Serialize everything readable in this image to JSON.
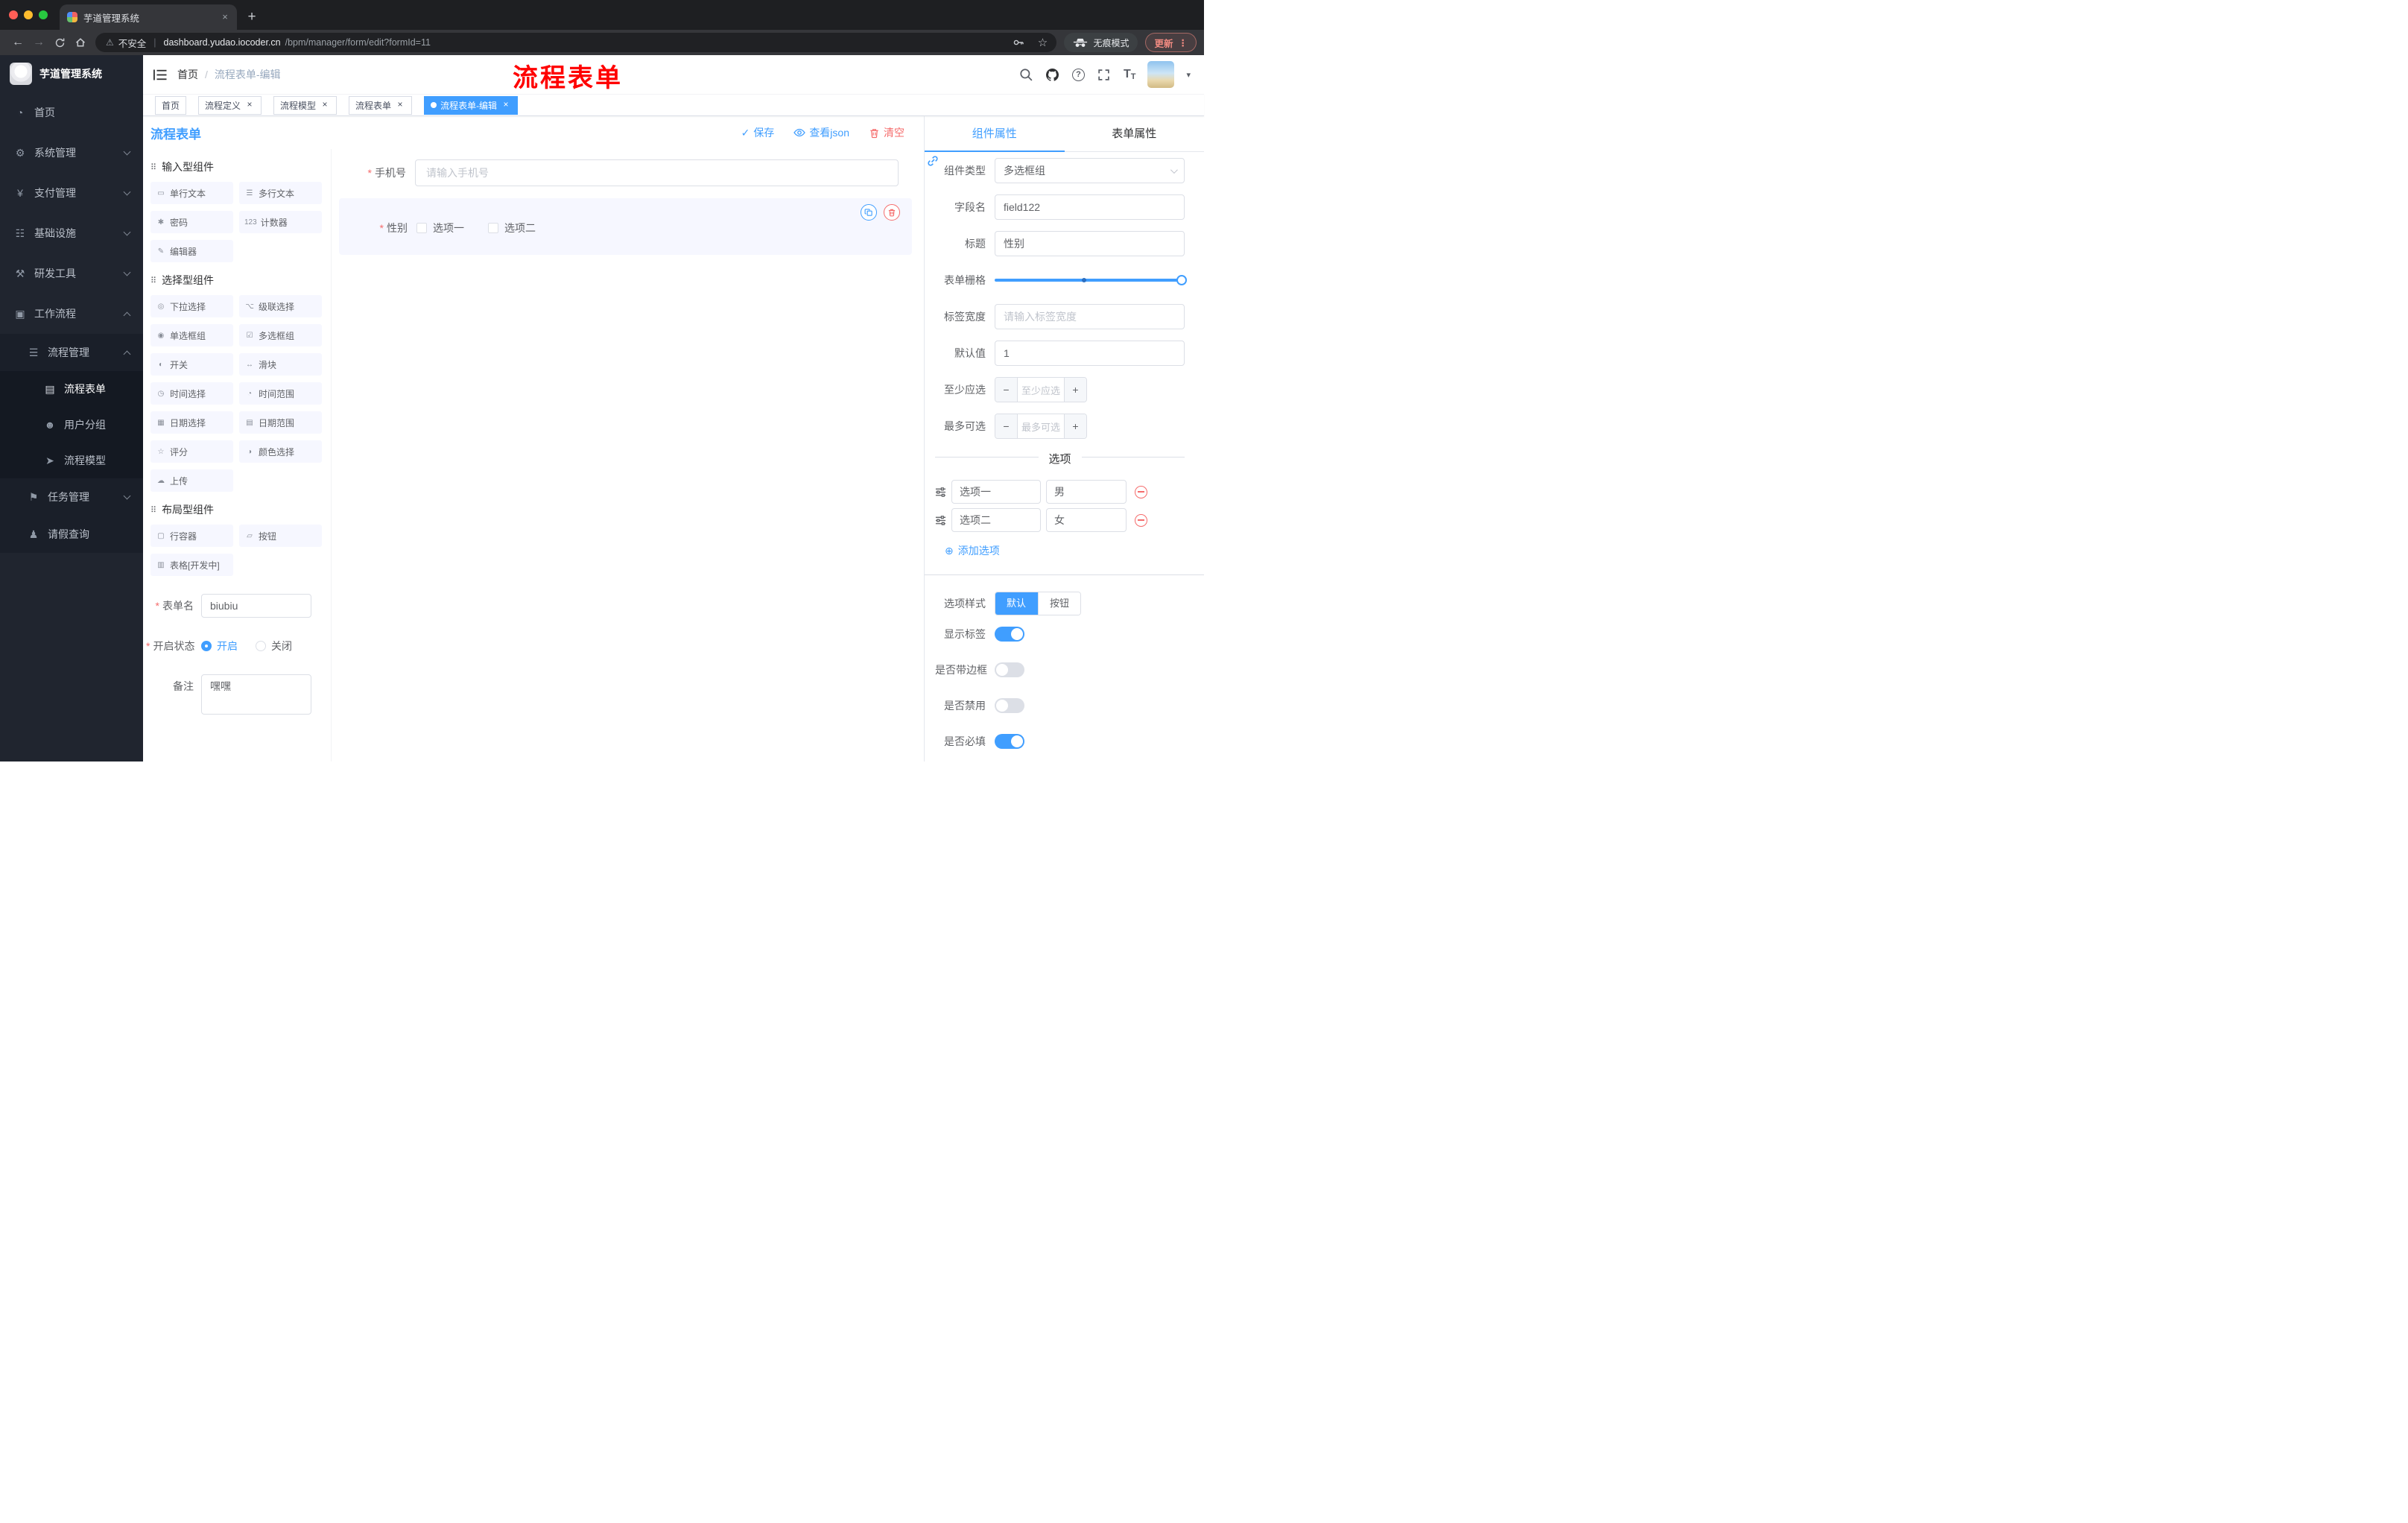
{
  "colors": {
    "primary": "#409eff",
    "danger": "#f56c6c",
    "annotation_red": "#ff0000",
    "sidebar_bg": "#20252f",
    "active_tag_bg": "#409eff"
  },
  "icons": {
    "warning": "⚠",
    "star": "☆",
    "dots": "⋮",
    "close": "×",
    "new_tab": "+",
    "back": "←",
    "forward": "→",
    "check": "✓",
    "caret": "▾",
    "minus": "−",
    "plus": "+",
    "plus_circle": "⊕",
    "question": "?",
    "font_size": "T",
    "group_drag": "⠿"
  },
  "browser": {
    "tab_title": "芋道管理系统",
    "security_label": "不安全",
    "url_domain": "dashboard.yudao.iocoder.cn",
    "url_path": "/bpm/manager/form/edit?formId=11",
    "incognito_label": "无痕模式",
    "update_label": "更新"
  },
  "sidebar": {
    "logo_title": "芋道管理系统",
    "items": {
      "home": {
        "icon": "◔",
        "label": "首页"
      },
      "system": {
        "icon": "⚙",
        "label": "系统管理"
      },
      "payment": {
        "icon": "¥",
        "label": "支付管理"
      },
      "infra": {
        "icon": "☷",
        "label": "基础设施"
      },
      "devtools": {
        "icon": "⚒",
        "label": "研发工具"
      },
      "workflow": {
        "icon": "▣",
        "label": "工作流程"
      },
      "process_mgmt": {
        "icon": "☰",
        "label": "流程管理"
      },
      "process_form": {
        "icon": "▤",
        "label": "流程表单"
      },
      "user_group": {
        "icon": "☻",
        "label": "用户分组"
      },
      "process_model": {
        "icon": "➤",
        "label": "流程模型"
      },
      "task_mgmt": {
        "icon": "⚑",
        "label": "任务管理"
      },
      "leave_query": {
        "icon": "♟",
        "label": "请假查询"
      }
    }
  },
  "header": {
    "breadcrumb_home": "首页",
    "breadcrumb_current": "流程表单-编辑",
    "annotation": "流程表单"
  },
  "tags": [
    {
      "label": "首页"
    },
    {
      "label": "流程定义"
    },
    {
      "label": "流程模型"
    },
    {
      "label": "流程表单"
    },
    {
      "label": "流程表单-编辑"
    }
  ],
  "toolbar": {
    "title": "流程表单",
    "save": "保存",
    "view_json": "查看json",
    "clear": "清空"
  },
  "library": {
    "groups": [
      {
        "title": "输入型组件",
        "items": [
          {
            "icon": "▭",
            "label": "单行文本"
          },
          {
            "icon": "☰",
            "label": "多行文本"
          },
          {
            "icon": "✱",
            "label": "密码"
          },
          {
            "icon": "123",
            "label": "计数器"
          },
          {
            "icon": "✎",
            "label": "编辑器"
          }
        ]
      },
      {
        "title": "选择型组件",
        "items": [
          {
            "icon": "◎",
            "label": "下拉选择"
          },
          {
            "icon": "⌥",
            "label": "级联选择"
          },
          {
            "icon": "◉",
            "label": "单选框组"
          },
          {
            "icon": "☑",
            "label": "多选框组"
          },
          {
            "icon": "◐",
            "label": "开关"
          },
          {
            "icon": "↔",
            "label": "滑块"
          },
          {
            "icon": "◷",
            "label": "时间选择"
          },
          {
            "icon": "◔",
            "label": "时间范围"
          },
          {
            "icon": "▦",
            "label": "日期选择"
          },
          {
            "icon": "▤",
            "label": "日期范围"
          },
          {
            "icon": "☆",
            "label": "评分"
          },
          {
            "icon": "◑",
            "label": "颜色选择"
          },
          {
            "icon": "☁",
            "label": "上传"
          }
        ]
      },
      {
        "title": "布局型组件",
        "items": [
          {
            "icon": "▢",
            "label": "行容器"
          },
          {
            "icon": "▱",
            "label": "按钮"
          },
          {
            "icon": "▥",
            "label": "表格[开发中]"
          }
        ]
      }
    ],
    "form": {
      "name_label": "表单名",
      "name_value": "biubiu",
      "status_label": "开启状态",
      "status_on": "开启",
      "status_off": "关闭",
      "remark_label": "备注",
      "remark_value": "嘿嘿"
    }
  },
  "canvas": {
    "phone_label": "手机号",
    "phone_placeholder": "请输入手机号",
    "gender_label": "性别",
    "gender_options": [
      "选项一",
      "选项二"
    ]
  },
  "props": {
    "tab_component": "组件属性",
    "tab_form": "表单属性",
    "rows": {
      "type_label": "组件类型",
      "type_value": "多选框组",
      "field_label": "字段名",
      "field_value": "field122",
      "title_label": "标题",
      "title_value": "性别",
      "grid_label": "表单栅格",
      "width_label": "标签宽度",
      "width_placeholder": "请输入标签宽度",
      "default_label": "默认值",
      "default_value": "1",
      "min_label": "至少应选",
      "min_placeholder": "至少应选",
      "max_label": "最多可选",
      "max_placeholder": "最多可选"
    },
    "options_title": "选项",
    "options": [
      {
        "label": "选项一",
        "value": "男"
      },
      {
        "label": "选项二",
        "value": "女"
      }
    ],
    "add_option": "添加选项",
    "style_label": "选项样式",
    "style_options": [
      "默认",
      "按钮"
    ],
    "switch_show_label": "显示标签",
    "switch_border_label": "是否带边框",
    "switch_disabled_label": "是否禁用",
    "switch_required_label": "是否必填"
  }
}
